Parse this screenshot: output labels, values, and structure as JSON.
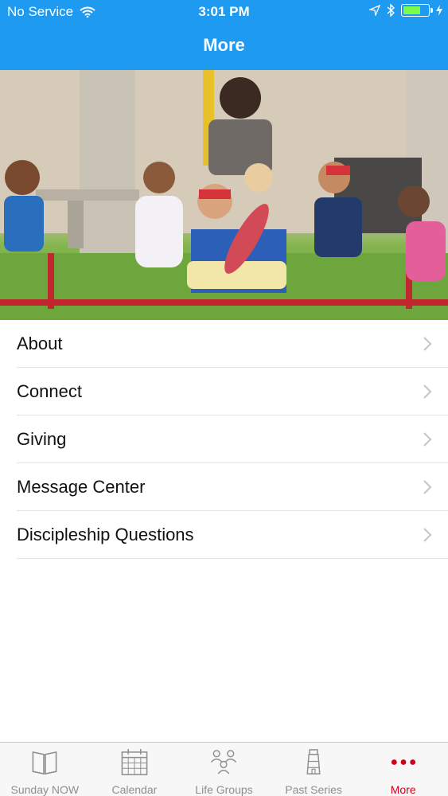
{
  "status_bar": {
    "carrier": "No Service",
    "time": "3:01 PM"
  },
  "nav": {
    "title": "More"
  },
  "menu": {
    "items": [
      {
        "label": "About"
      },
      {
        "label": "Connect"
      },
      {
        "label": "Giving"
      },
      {
        "label": "Message Center"
      },
      {
        "label": "Discipleship Questions"
      }
    ]
  },
  "tabbar": {
    "tabs": [
      {
        "label": "Sunday NOW",
        "icon": "book-icon"
      },
      {
        "label": "Calendar",
        "icon": "calendar-icon"
      },
      {
        "label": "Life Groups",
        "icon": "people-icon"
      },
      {
        "label": "Past Series",
        "icon": "lighthouse-icon"
      },
      {
        "label": "More",
        "icon": "more-dots-icon"
      }
    ],
    "active": "More"
  },
  "colors": {
    "nav_background": "#1E9BF0",
    "active_tab": "#d0021b",
    "inactive_tab": "#8e8e93"
  }
}
